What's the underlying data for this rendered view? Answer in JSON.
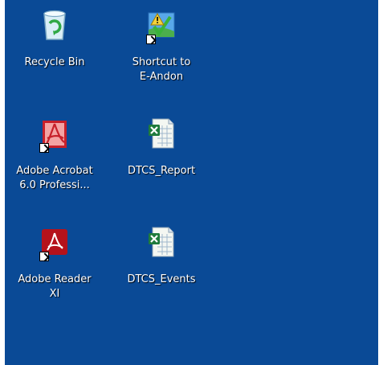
{
  "desktop": {
    "background_color": "#0a4a96",
    "icons": [
      {
        "line1": "Recycle Bin",
        "line2": "",
        "icon": "recycle-bin-icon"
      },
      {
        "line1": "Shortcut to",
        "line2": "E-Andon",
        "icon": "e-andon-warning-icon"
      },
      {
        "line1": "Adobe Acrobat",
        "line2": "6.0 Professi...",
        "icon": "adobe-acrobat-icon"
      },
      {
        "line1": "DTCS_Report",
        "line2": "",
        "icon": "excel-spreadsheet-icon"
      },
      {
        "line1": "Adobe Reader",
        "line2": "XI",
        "icon": "adobe-reader-icon"
      },
      {
        "line1": "DTCS_Events",
        "line2": "",
        "icon": "excel-spreadsheet-icon"
      }
    ]
  }
}
